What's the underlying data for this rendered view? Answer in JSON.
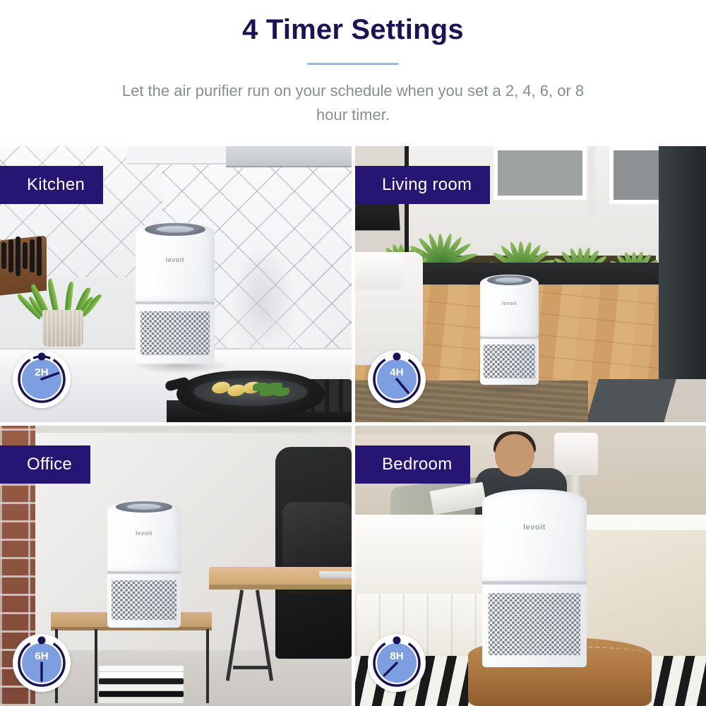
{
  "header": {
    "title": "4 Timer Settings",
    "subtitle": "Let the air purifier run on your schedule when you set a 2, 4, 6, or 8 hour timer.",
    "divider_color": "#9cb8d9",
    "title_color": "#1a1356",
    "subtitle_color": "#848e94"
  },
  "theme": {
    "badge_bg": "#261572",
    "badge_text": "#ffffff",
    "timer_ring": "#1a1356",
    "timer_face": "#7d9ee0",
    "timer_disc": "#ffffff",
    "timer_label": "#ffffff"
  },
  "panels": [
    {
      "id": "kitchen",
      "room_label": "Kitchen",
      "timer": {
        "label": "2H",
        "hours": 2,
        "hand_angle_deg": 70
      },
      "product_logo": "levoit",
      "scene_items": [
        "herringbone-tile-backsplash",
        "knife-block",
        "potted-plant",
        "marble-countertop",
        "cast-iron-skillet",
        "gas-stove",
        "range-hood",
        "steam"
      ]
    },
    {
      "id": "living-room",
      "room_label": "Living room",
      "timer": {
        "label": "4H",
        "hours": 4,
        "hand_angle_deg": 140
      },
      "product_logo": "levoit",
      "scene_items": [
        "sliding-glass-door",
        "agave-plants",
        "wood-floor",
        "white-armchair",
        "area-rug",
        "dark-pillar",
        "planter"
      ]
    },
    {
      "id": "office",
      "room_label": "Office",
      "timer": {
        "label": "6H",
        "hours": 6,
        "hand_angle_deg": 180
      },
      "product_logo": "levoit",
      "scene_items": [
        "exposed-brick-wall",
        "grey-wall",
        "wood-side-table",
        "wood-desk",
        "black-leather-chair",
        "stack-of-books",
        "laptop"
      ]
    },
    {
      "id": "bedroom",
      "room_label": "Bedroom",
      "timer": {
        "label": "8H",
        "hours": 8,
        "hand_angle_deg": 225
      },
      "product_logo": "levoit",
      "scene_items": [
        "man-reading-in-bed",
        "white-bedding",
        "table-lamp",
        "leather-ottoman",
        "striped-rug",
        "headboard"
      ]
    }
  ]
}
